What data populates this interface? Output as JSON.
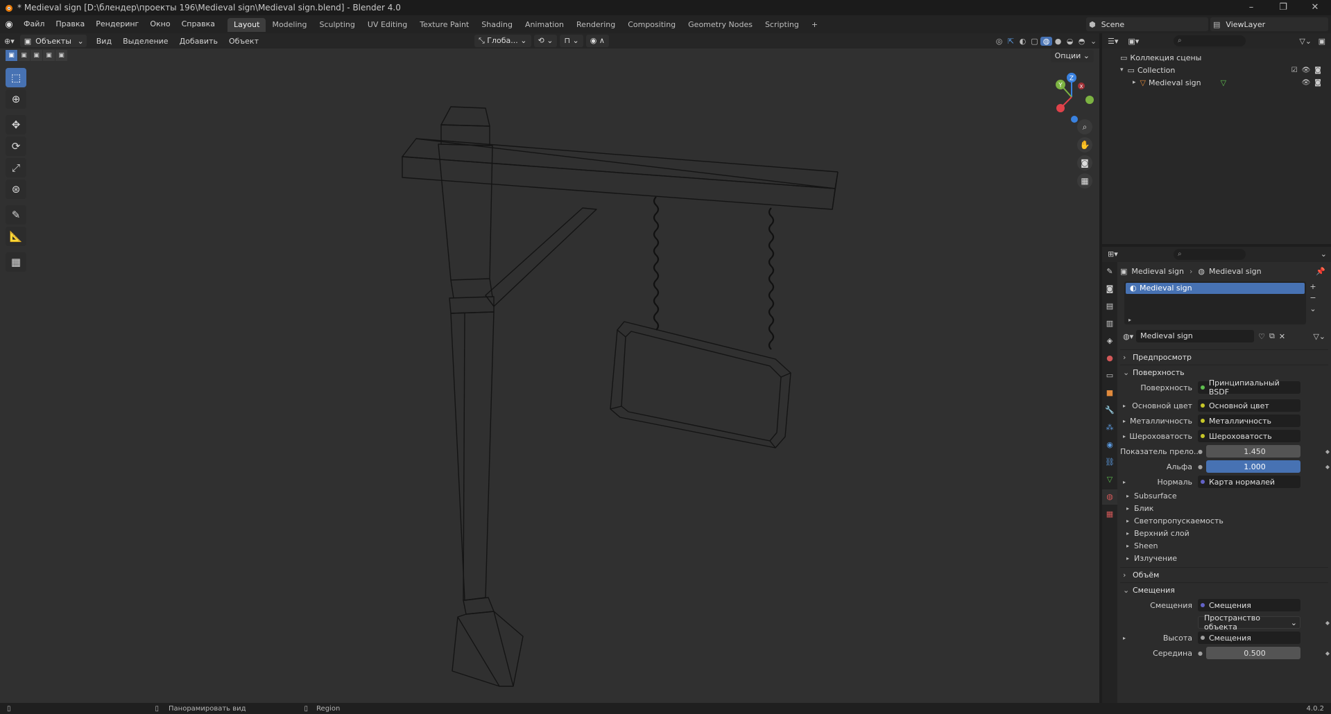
{
  "window": {
    "title": "* Medieval sign [D:\\блендер\\проекты 196\\Medieval sign\\Medieval sign.blend] - Blender 4.0",
    "controls": [
      "–",
      "❐",
      "✕"
    ]
  },
  "topbar": {
    "menu": [
      "Файл",
      "Правка",
      "Рендеринг",
      "Окно",
      "Справка"
    ],
    "workspaces": [
      "Layout",
      "Modeling",
      "Sculpting",
      "UV Editing",
      "Texture Paint",
      "Shading",
      "Animation",
      "Rendering",
      "Compositing",
      "Geometry Nodes",
      "Scripting"
    ],
    "active_workspace": "Layout",
    "add_workspace": "+",
    "scene": "Scene",
    "view_layer": "ViewLayer"
  },
  "viewport": {
    "mode": "Объекты",
    "menu": [
      "Вид",
      "Выделение",
      "Добавить",
      "Объект"
    ],
    "orientation": "Глоба...",
    "options": "Опции",
    "tools": [
      "select-box",
      "cursor",
      "move",
      "rotate",
      "scale",
      "transform",
      "annotate",
      "measure",
      "add-cube"
    ]
  },
  "gizmo": {
    "x": "X",
    "y": "Y",
    "z": "Z"
  },
  "outliner": {
    "root": "Коллекция сцены",
    "collection": "Collection",
    "object": "Medieval sign"
  },
  "properties": {
    "breadcrumb": [
      "Medieval sign",
      "Medieval sign"
    ],
    "material_slot": "Medieval sign",
    "material_name": "Medieval sign",
    "panels": {
      "preview": "Предпросмотр",
      "surface": "Поверхность",
      "volume": "Объём",
      "displacement": "Смещения"
    },
    "surface": {
      "shader_label": "Поверхность",
      "shader_value": "Принципиальный BSDF",
      "base_color_label": "Основной цвет",
      "base_color_value": "Основной цвет",
      "metallic_label": "Металличность",
      "metallic_value": "Металличность",
      "roughness_label": "Шероховатость",
      "roughness_value": "Шероховатость",
      "ior_label": "Показатель прело...",
      "ior_value": "1.450",
      "alpha_label": "Альфа",
      "alpha_value": "1.000",
      "normal_label": "Нормаль",
      "normal_value": "Карта нормалей",
      "subpanels": [
        "Subsurface",
        "Блик",
        "Светопропускаемость",
        "Верхний слой",
        "Sheen",
        "Излучение"
      ]
    },
    "displacement": {
      "disp_label": "Смещения",
      "disp_value": "Смещения",
      "space_value": "Пространство объекта",
      "height_label": "Высота",
      "height_value": "Смещения",
      "midlevel_label": "Середина",
      "midlevel_value": "0.500"
    }
  },
  "statusbar": {
    "hint1": "Панорамировать вид",
    "hint2": "Region",
    "version": "4.0.2"
  },
  "colors": {
    "accent": "#4772b3",
    "axis_x": "#e0424a",
    "axis_y": "#7cb342",
    "axis_z": "#3a82e0",
    "shader_dot_green": "#5fbf4f",
    "shader_dot_yellow": "#c7c729",
    "shader_dot_gray": "#a1a1a1",
    "shader_dot_purple": "#6363c7"
  }
}
